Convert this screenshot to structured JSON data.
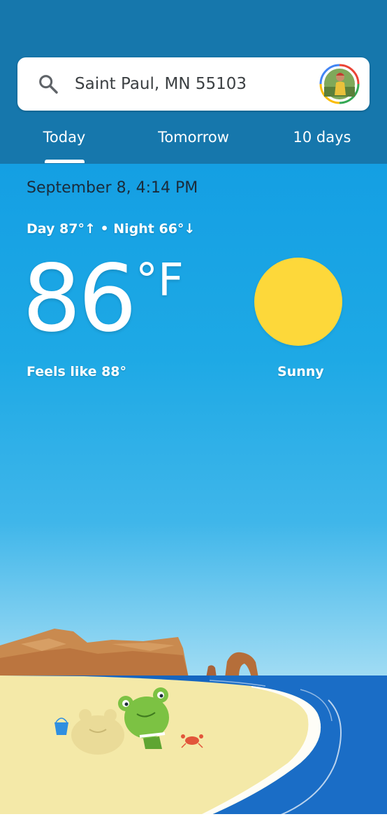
{
  "search": {
    "location": "Saint Paul, MN 55103"
  },
  "tabs": [
    {
      "label": "Today",
      "selected": true
    },
    {
      "label": "Tomorrow",
      "selected": false
    },
    {
      "label": "10 days",
      "selected": false
    }
  ],
  "weather": {
    "datetime": "September 8, 4:14 PM",
    "day_night": "Day 87°↑ • Night 66°↓",
    "temperature": "86",
    "unit": "°F",
    "feels_like": "Feels like 88°",
    "condition": "Sunny",
    "condition_icon": "sun-icon"
  },
  "colors": {
    "header": "#1677ac",
    "sky_top": "#149fe3",
    "sun": "#fdd83a",
    "sea": "#1565c0"
  }
}
